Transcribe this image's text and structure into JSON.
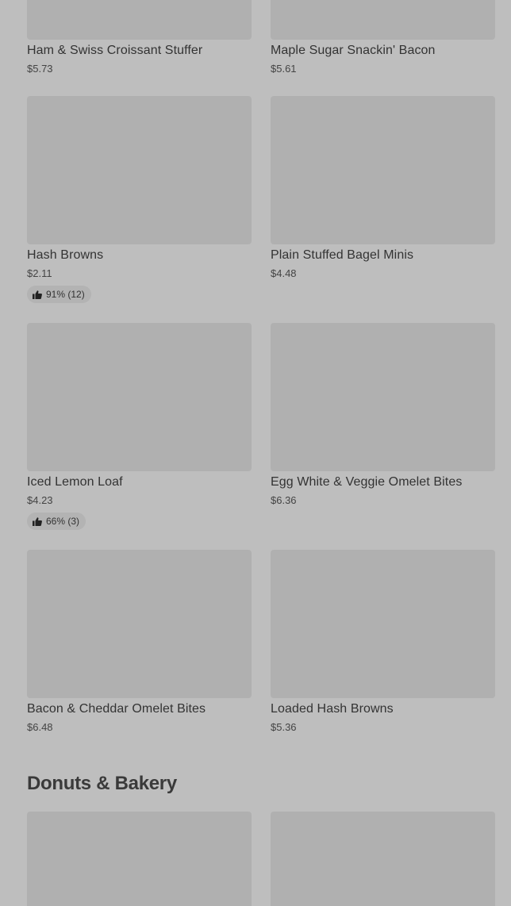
{
  "rows": [
    {
      "items": [
        {
          "name": "Ham & Swiss Croissant Stuffer",
          "price": "$5.73"
        },
        {
          "name": "Maple Sugar Snackin' Bacon",
          "price": "$5.61"
        }
      ]
    },
    {
      "items": [
        {
          "name": "Hash Browns",
          "price": "$2.11",
          "rating": "91% (12)"
        },
        {
          "name": "Plain Stuffed Bagel Minis",
          "price": "$4.48"
        }
      ]
    },
    {
      "items": [
        {
          "name": "Iced Lemon Loaf",
          "price": "$4.23",
          "rating": "66% (3)"
        },
        {
          "name": "Egg White & Veggie Omelet Bites",
          "price": "$6.36"
        }
      ]
    },
    {
      "items": [
        {
          "name": "Bacon & Cheddar Omelet Bites",
          "price": "$6.48"
        },
        {
          "name": "Loaded Hash Browns",
          "price": "$5.36"
        }
      ]
    }
  ],
  "section": {
    "title": "Donuts & Bakery"
  },
  "icons": {
    "rating": "thumbs-up-icon"
  },
  "colors": {
    "background": "#bebebe",
    "image_placeholder": "#b0b0b0",
    "rating_pill": "#b3b3b3",
    "text": "#333333"
  }
}
